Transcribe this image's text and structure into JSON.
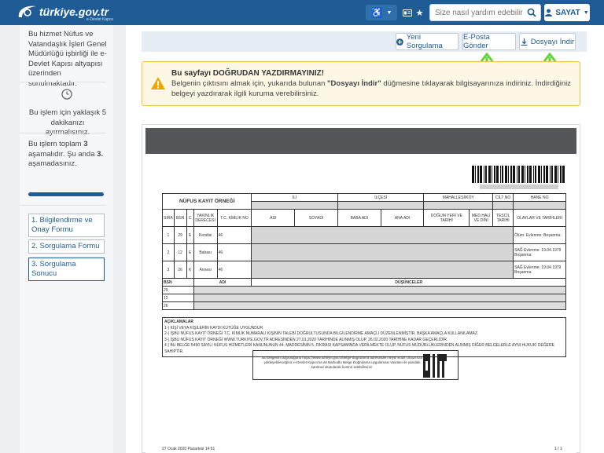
{
  "header": {
    "logo_text": "türkiye.gov.tr",
    "logo_subtitle": "e-Devlet Kapısı",
    "search_placeholder": "Size nasıl yardım edebilirim?",
    "user_label": "SAYAT",
    "accent": "#1f5c96"
  },
  "sidebar": {
    "intro": "Bu hizmet Nüfus ve Vatandaşlık İşleri Genel Müdürlüğü işbirliği ile e-Devlet Kapısı altyapısı üzerinden sunulmaktadır.",
    "time_note": "Bu işlem için yaklaşık 5 dakikanızı ayırmalısınız.",
    "steps_prefix": "Bu işlem toplam",
    "steps_total": "3",
    "steps_mid": "aşamalıdır. Şu anda",
    "steps_current": "3.",
    "steps_suffix": "aşamadasınız.",
    "progress": 1.0,
    "steps": [
      {
        "label": "1. Bilgilendirme ve Onay Formu"
      },
      {
        "label": "2. Sorgulama Formu"
      },
      {
        "label": "3. Sorgulama Sonucu"
      }
    ]
  },
  "toolbar": {
    "new_query": "Yeni Sorgulama",
    "email": "E-Posta Gönder",
    "download": "Dosyayı İndir"
  },
  "warning": {
    "title": "Bu sayfayı DOĞRUDAN YAZDIRMAYINIZ!",
    "text_1": "Belgenin çıktısını almak için, yukarıda bulunan",
    "text_bold": "\"Dosyayı İndir\"",
    "text_2": "düğmesine tıklayarak bilgisayarınıza indiriniz. İndirdiğiniz belgeyi yazdırarak ilgili kuruma verebilirsiniz."
  },
  "document": {
    "title": "NÜFUS KAYIT ÖRNEĞİ",
    "top_labels": [
      "İLİ",
      "İLÇESİ",
      "MAHALLESİ/KÖY",
      "CİLT NO",
      "HANE NO"
    ],
    "columns": [
      "SIRA",
      "BSN",
      "C",
      "YAKINLIK DERECESİ",
      "T.C. KİMLİK NO",
      "ADI",
      "SOYADI",
      "BABA ADI",
      "ANA ADI",
      "DOĞUM YERİ VE TARİHİ",
      "MED.HALİ VE DİNİ",
      "TESCİL TARİHİ",
      "OLAYLAR VE TARİHLERİ"
    ],
    "rows": [
      {
        "sira": "1",
        "bsn": "29",
        "c": "E",
        "yakinlik": "Kendisi",
        "tc": "46",
        "olay": "Ölüm: Evlenme: Boşanma:"
      },
      {
        "sira": "2",
        "bsn": "12",
        "c": "E",
        "yakinlik": "Babası",
        "tc": "46",
        "olay": "SAĞ Evlenme: 19.04.1979 Boşanma:"
      },
      {
        "sira": "3",
        "bsn": "26",
        "c": "K",
        "yakinlik": "Annesi",
        "tc": "46",
        "olay": "SAĞ Evlenme: 19.04.1979 Boşanma:"
      }
    ],
    "notes_header": [
      "BSN",
      "ADI",
      "DÜŞÜNCELER"
    ],
    "notes_bsn": [
      "29",
      "12",
      "26"
    ],
    "aciklamalar_title": "AÇIKLAMALAR",
    "aciklamalar": [
      "1-) KİŞİ VEYA KİŞİLERİN KAYDI KÜTÜĞE UYGUNDUR.",
      "2-) İŞBU NÜFUS KAYIT ÖRNEĞİ T.C. KİMLİK NUMARALI KİŞİNİN TALEBİ DOĞRULTUSUNDA BİLGİLENDİRME AMAÇLI DÜZENLENMİŞTİR. BAŞKA AMAÇLA KULLANILAMAZ.",
      "3-) İŞBU NÜFUS KAYIT ÖRNEĞİ WWW.TURKIYE.GOV.TR ADRESİNDEN 27.01.2020 TARİHİNDE ALINMIŞ OLUP, 26.02.2020 TARİHİNE KADAR GEÇERLİDİR.",
      "4-) BU BELGE 5490 SAYILI NÜFUS HİZMETLERİ KANUNUNUN 44. MADDESİNİN 5. FIKRASI KAPSAMINDA VERİLMEKTE OLUP, NÜFUS MÜDÜRLÜKLERİNDEN ALINMIŞ DİĞER BELGELERLE AYNI HUKUKİ DEĞERE SAHİPTİR."
    ],
    "verification": "Bu belgenin doğruluğunu https://www.turkiye.gov.tr/belge-dogrulama adresinden veya mobil cihazınıza yükleyebileceğiniz e-Devlet Kapısı'na ait Barkodlu Belge Doğrulama uygulaması vasıtası ile yandaki karekod okutularak kontrol edebilirsiniz.",
    "footer_date": "27 Ocak 2020 Pazartesi 14:51",
    "page_no": "1 / 1"
  }
}
